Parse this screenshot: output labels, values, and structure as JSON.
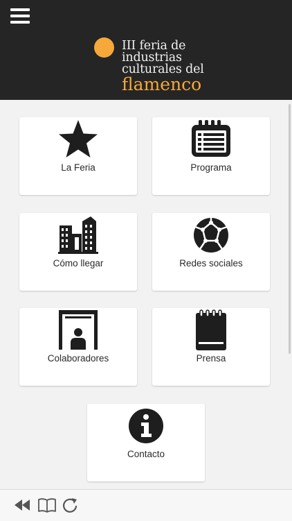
{
  "header": {
    "menu_icon": "hamburger-menu-icon",
    "logo": {
      "line1": "III feria de",
      "line2": "industrias",
      "line3": "culturales del",
      "line4": "flamenco",
      "dot_color": "#f6a83a",
      "accent_color": "#f6a83a"
    },
    "background": "#252525"
  },
  "menu": {
    "items": [
      {
        "label": "La Feria",
        "icon": "star-icon"
      },
      {
        "label": "Programa",
        "icon": "calendar-list-icon"
      },
      {
        "label": "Cómo llegar",
        "icon": "city-buildings-icon"
      },
      {
        "label": "Redes sociales",
        "icon": "globe-network-icon"
      },
      {
        "label": "Colaboradores",
        "icon": "booth-person-icon"
      },
      {
        "label": "Prensa",
        "icon": "notepad-icon"
      },
      {
        "label": "Contacto",
        "icon": "info-icon"
      }
    ]
  },
  "toolbar": {
    "buttons": [
      {
        "icon": "rewind-back-icon"
      },
      {
        "icon": "book-open-icon"
      },
      {
        "icon": "reload-icon"
      }
    ]
  }
}
